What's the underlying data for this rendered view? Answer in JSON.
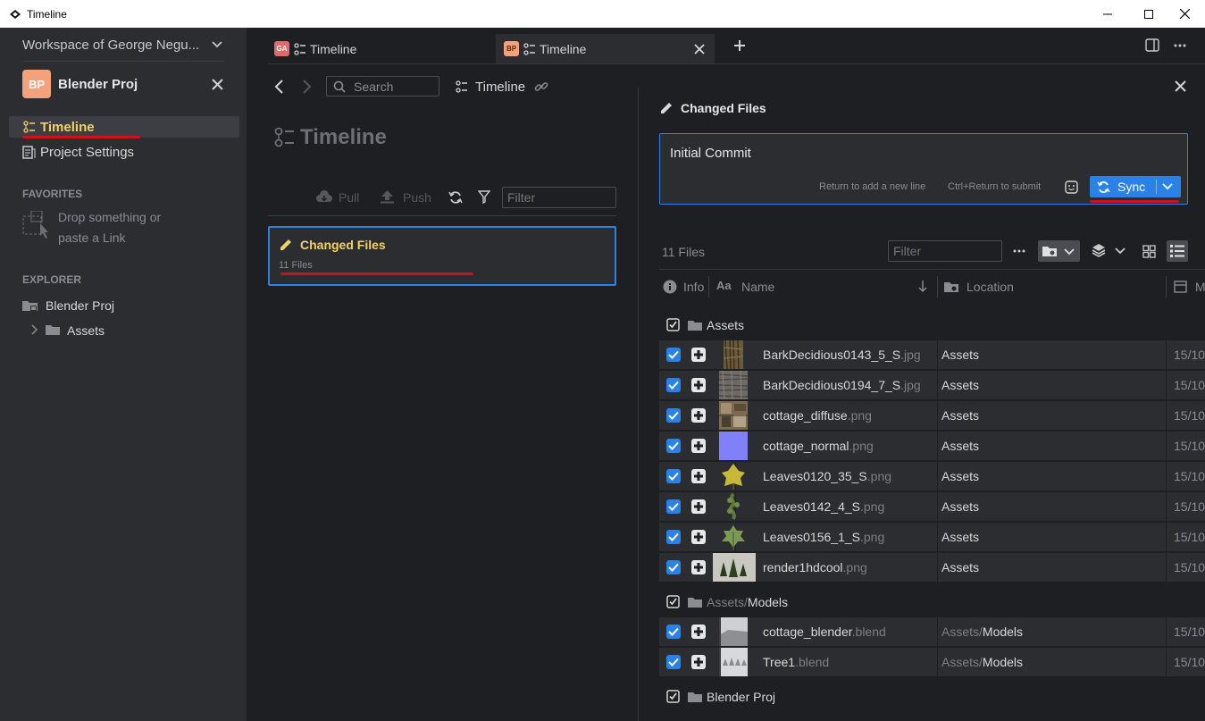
{
  "window": {
    "title": "Timeline"
  },
  "sidebar": {
    "workspace": "Workspace of George Negu...",
    "project": {
      "badge": "BP",
      "name": "Blender Proj"
    },
    "nav": [
      {
        "label": "Timeline"
      },
      {
        "label": "Project Settings"
      }
    ],
    "favorites": {
      "header": "FAVORITES",
      "drop_line1": "Drop something or",
      "drop_line2": "paste a Link"
    },
    "explorer": {
      "header": "EXPLORER",
      "root": "Blender Proj",
      "child": "Assets"
    }
  },
  "tabs": [
    {
      "badge": "GA",
      "label": "Timeline"
    },
    {
      "badge": "BP",
      "label": "Timeline"
    }
  ],
  "toolbar": {
    "search_placeholder": "Search",
    "crumb": "Timeline"
  },
  "timeline": {
    "title": "Timeline",
    "pull": "Pull",
    "push": "Push",
    "filter_placeholder": "Filter",
    "card": {
      "title": "Changed Files",
      "subtitle": "11 Files"
    }
  },
  "changes": {
    "title": "Changed Files",
    "commit_message": "Initial Commit",
    "hint_newline": "Return to add a new line",
    "hint_submit": "Ctrl+Return to submit",
    "sync_label": "Sync",
    "count": "11 Files",
    "filter_placeholder": "Filter",
    "columns": {
      "info": "Info",
      "name": "Name",
      "location": "Location",
      "date": "M"
    },
    "groups": [
      {
        "label": "Assets",
        "files": [
          {
            "name": "BarkDecidious0143_5_S",
            "ext": ".jpg",
            "location": "Assets",
            "date": "15/10",
            "thumb": "bark1"
          },
          {
            "name": "BarkDecidious0194_7_S",
            "ext": ".jpg",
            "location": "Assets",
            "date": "15/10",
            "thumb": "bark2"
          },
          {
            "name": "cottage_diffuse",
            "ext": ".png",
            "location": "Assets",
            "date": "15/10",
            "thumb": "cottage"
          },
          {
            "name": "cottage_normal",
            "ext": ".png",
            "location": "Assets",
            "date": "15/10",
            "thumb": "normal"
          },
          {
            "name": "Leaves0120_35_S",
            "ext": ".png",
            "location": "Assets",
            "date": "15/10",
            "thumb": "leaf1"
          },
          {
            "name": "Leaves0142_4_S",
            "ext": ".png",
            "location": "Assets",
            "date": "15/10",
            "thumb": "leaf2"
          },
          {
            "name": "Leaves0156_1_S",
            "ext": ".png",
            "location": "Assets",
            "date": "15/10",
            "thumb": "leaf3"
          },
          {
            "name": "render1hdcool",
            "ext": ".png",
            "location": "Assets",
            "date": "15/10",
            "thumb": "render"
          }
        ]
      },
      {
        "label_prefix": "Assets/",
        "label": "Models",
        "files": [
          {
            "name": "cottage_blender",
            "ext": ".blend",
            "location_prefix": "Assets/",
            "location": "Models",
            "date": "15/10",
            "thumb": "blend1"
          },
          {
            "name": "Tree1",
            "ext": ".blend",
            "location_prefix": "Assets/",
            "location": "Models",
            "date": "15/10",
            "thumb": "blend2"
          }
        ]
      },
      {
        "label": "Blender Proj",
        "files": []
      }
    ]
  },
  "colors": {
    "accent": "#2b82e6",
    "highlight_yellow": "#f2d16b",
    "badge_orange": "#f4a27b",
    "annotation_red": "#d0101a"
  }
}
